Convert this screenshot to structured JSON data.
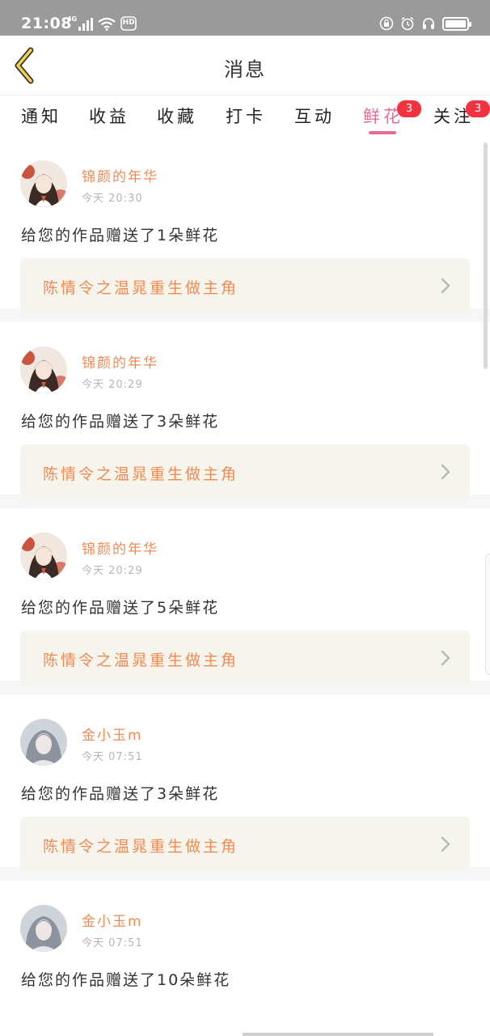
{
  "status_bar": {
    "time": "21:08",
    "network": "4G",
    "hd": "HD",
    "right_icons": [
      "lock-icon",
      "alarm-icon",
      "headphones-icon",
      "battery-icon"
    ]
  },
  "header": {
    "title": "消息",
    "back_icon": "chevron-left-icon"
  },
  "tabs": [
    {
      "label": "通知"
    },
    {
      "label": "收益"
    },
    {
      "label": "收藏"
    },
    {
      "label": "打卡"
    },
    {
      "label": "互动"
    },
    {
      "label": "鲜花",
      "active": true,
      "badge": "3"
    },
    {
      "label": "关注",
      "badge": "3"
    }
  ],
  "colors": {
    "accent": "#e86a95",
    "username": "#f08a52",
    "badge": "#f2323f",
    "link_bg": "#f5f5ed"
  },
  "messages": [
    {
      "user": "锦颜的年华",
      "time": "今天 20:30",
      "text": "给您的作品赠送了1朵鲜花",
      "work": "陈情令之温晁重生做主角"
    },
    {
      "user": "锦颜的年华",
      "time": "今天 20:29",
      "text": "给您的作品赠送了3朵鲜花",
      "work": "陈情令之温晁重生做主角"
    },
    {
      "user": "锦颜的年华",
      "time": "今天 20:29",
      "text": "给您的作品赠送了5朵鲜花",
      "work": "陈情令之温晁重生做主角"
    },
    {
      "user": "金小玉m",
      "time": "今天 07:51",
      "text": "给您的作品赠送了3朵鲜花",
      "work": "陈情令之温晁重生做主角"
    },
    {
      "user": "金小玉m",
      "time": "今天 07:51",
      "text": "给您的作品赠送了10朵鲜花",
      "work": ""
    }
  ]
}
